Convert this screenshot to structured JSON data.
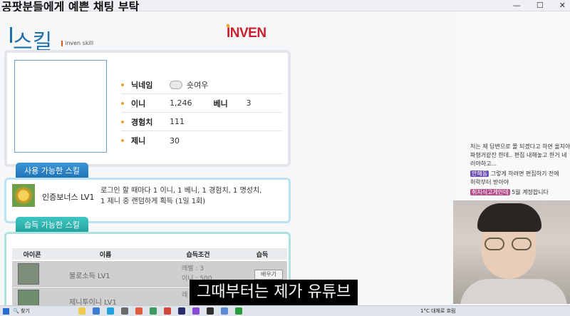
{
  "stream": {
    "title": "공팟분들에게 예쁜 채팅 부탁",
    "subtitle": "그때부터는 제가 유튜브"
  },
  "window": {
    "minimize": "—",
    "maximize": "☐",
    "close": "✕"
  },
  "header": {
    "skill_logo": "스킬",
    "skill_sub": "inven skill",
    "brand": "INVEN"
  },
  "profile": {
    "rows": [
      {
        "label": "닉네임",
        "value": "숏여우"
      },
      {
        "label": "이니",
        "value": "1,246",
        "label2": "베니",
        "value2": "3"
      },
      {
        "label": "경험치",
        "value": "111"
      },
      {
        "label": "제니",
        "value": "30"
      }
    ]
  },
  "usable_skills": {
    "tab": "사용 가능한 스킬",
    "items": [
      {
        "name": "인증보너스 LV1",
        "desc": "로그인 할 때마다 1 이니, 1 베니, 1 경험치, 1 명성치, 1 제니 중 랜덤하게 획득 (1일 1회)"
      }
    ]
  },
  "learnable_skills": {
    "tab": "습득 가능한 스킬",
    "columns": [
      "아이콘",
      "이름",
      "습득조건",
      "습득"
    ],
    "rows": [
      {
        "name": "불로소득 LV1",
        "cond1": "레벨 : 3",
        "cond2": "이니 : 500",
        "button": "배우기"
      },
      {
        "name": "제니투이니 LV1",
        "cond1": "레",
        "cond2": "",
        "button": ""
      }
    ]
  },
  "chat": {
    "lines": [
      {
        "text": "저는 제 답변으로 쫄 되겠다고 하면 올지아"
      },
      {
        "text": "파형거같잔 한데.. 편집 내해놓고 한거 네"
      },
      {
        "text": "러야하고..."
      },
      {
        "nick": "안해동",
        "text": "그렇게 하려면 편집하기 전에"
      },
      {
        "text": "허락부터 받아야"
      },
      {
        "nick": "취지식고게인데",
        "text": "5월 계정합니다"
      }
    ]
  },
  "taskbar": {
    "search": "찾기",
    "weather": "1°C 대체로 흐림"
  }
}
